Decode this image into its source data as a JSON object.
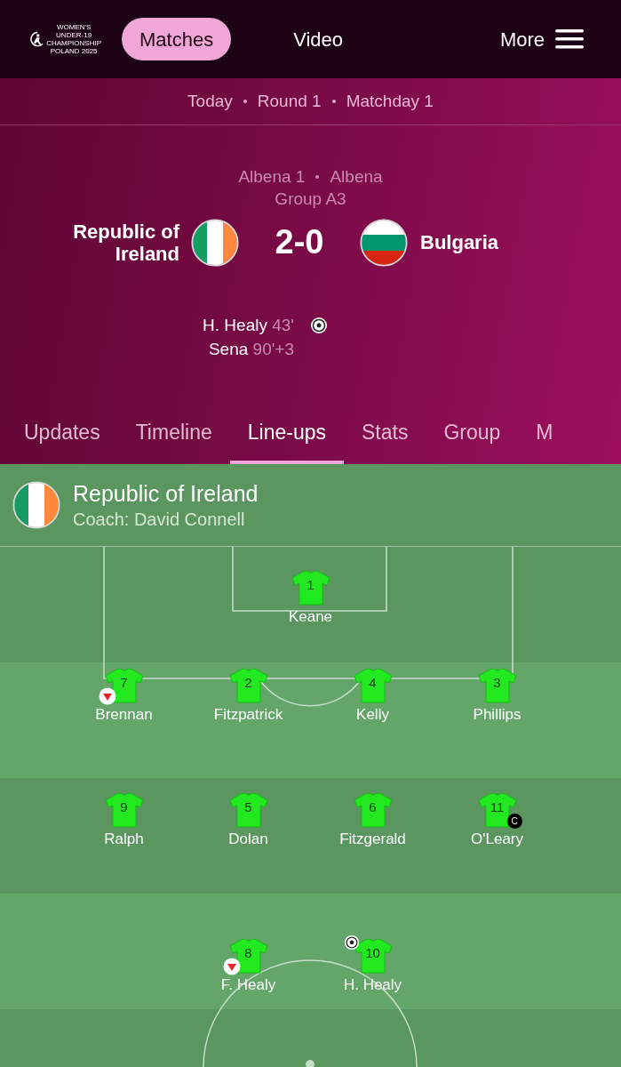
{
  "header": {
    "logo_text": [
      "WOMEN'S",
      "UNDER-19",
      "CHAMPIONSHIP",
      "POLAND 2025"
    ],
    "nav": [
      {
        "label": "Matches",
        "selected": true
      },
      {
        "label": "Video",
        "selected": false
      }
    ],
    "more": "More"
  },
  "breadcrumb": [
    "Today",
    "Round 1",
    "Matchday 1"
  ],
  "venue": [
    "Albena 1",
    "Albena"
  ],
  "group": "Group A3",
  "home": {
    "name": "Republic of Ireland"
  },
  "score": "2-0",
  "away": {
    "name": "Bulgaria"
  },
  "goals": [
    {
      "player": "H. Healy",
      "minute": "43'",
      "ball": true
    },
    {
      "player": "Sena",
      "minute": "90'+3",
      "ball": false
    }
  ],
  "tabs": [
    {
      "label": "Updates",
      "selected": false
    },
    {
      "label": "Timeline",
      "selected": false
    },
    {
      "label": "Line-ups",
      "selected": true
    },
    {
      "label": "Stats",
      "selected": false
    },
    {
      "label": "Group",
      "selected": false
    },
    {
      "label": "M",
      "selected": false
    }
  ],
  "lineup": {
    "team": "Republic of Ireland",
    "coach": "Coach: David Connell",
    "rows": [
      [
        {
          "number": "1",
          "name": "Keane",
          "substituted": false,
          "goal": false
        }
      ],
      [
        {
          "number": "7",
          "name": "Brennan",
          "substituted": true,
          "goal": false
        },
        {
          "number": "2",
          "name": "Fitzpatrick",
          "substituted": false,
          "goal": false
        },
        {
          "number": "4",
          "name": "Kelly",
          "substituted": false,
          "goal": false
        },
        {
          "number": "3",
          "name": "Phillips",
          "substituted": false,
          "goal": false
        }
      ],
      [
        {
          "number": "9",
          "name": "Ralph",
          "substituted": false,
          "goal": false
        },
        {
          "number": "5",
          "name": "Dolan",
          "substituted": false,
          "goal": false
        },
        {
          "number": "6",
          "name": "Fitzgerald",
          "substituted": false,
          "goal": false
        },
        {
          "number": "11",
          "name": "O'Leary",
          "substituted": false,
          "goal": false,
          "captain_badge": "C"
        }
      ],
      [
        "",
        {
          "number": "8",
          "name": "F. Healy",
          "substituted": true,
          "goal": false
        },
        {
          "number": "10",
          "name": "H. Healy",
          "substituted": false,
          "goal": true
        },
        ""
      ]
    ]
  }
}
